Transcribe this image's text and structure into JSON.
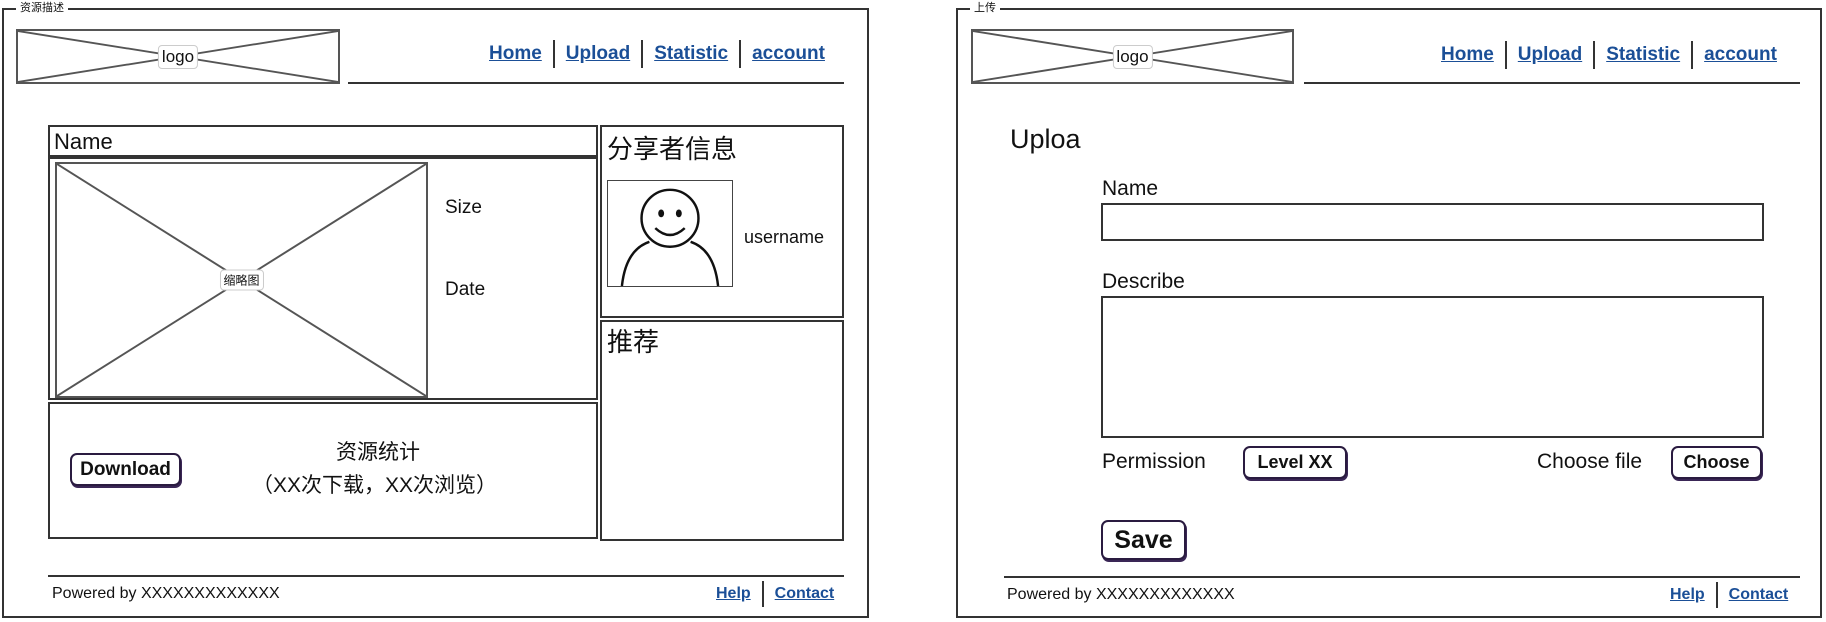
{
  "left": {
    "frame_title": "资源描述",
    "logo_label": "logo",
    "nav": [
      "Home",
      "Upload",
      "Statistic",
      "account"
    ],
    "name_label": "Name",
    "thumbnail_label": "缩略图",
    "size_label": "Size",
    "date_label": "Date",
    "sharer_title": "分享者信息",
    "username": "username",
    "recommend_title": "推荐",
    "download_label": "Download",
    "stats_title": "资源统计",
    "stats_detail": "（XX次下载，XX次浏览）",
    "footer_text": "Powered by XXXXXXXXXXXXX",
    "footer_links": [
      "Help",
      "Contact"
    ]
  },
  "right": {
    "frame_title": "上传",
    "logo_label": "logo",
    "nav": [
      "Home",
      "Upload",
      "Statistic",
      "account"
    ],
    "page_heading": "Uploa",
    "name_label": "Name",
    "name_value": "",
    "describe_label": "Describe",
    "describe_value": "",
    "permission_label": "Permission",
    "permission_value": "Level XX",
    "choose_file_label": "Choose file",
    "choose_button": "Choose",
    "save_button": "Save",
    "footer_text": "Powered by XXXXXXXXXXXXX",
    "footer_links": [
      "Help",
      "Contact"
    ]
  },
  "colors": {
    "link": "#1b4f97",
    "border": "#333333",
    "button_border": "#2a1b40"
  }
}
